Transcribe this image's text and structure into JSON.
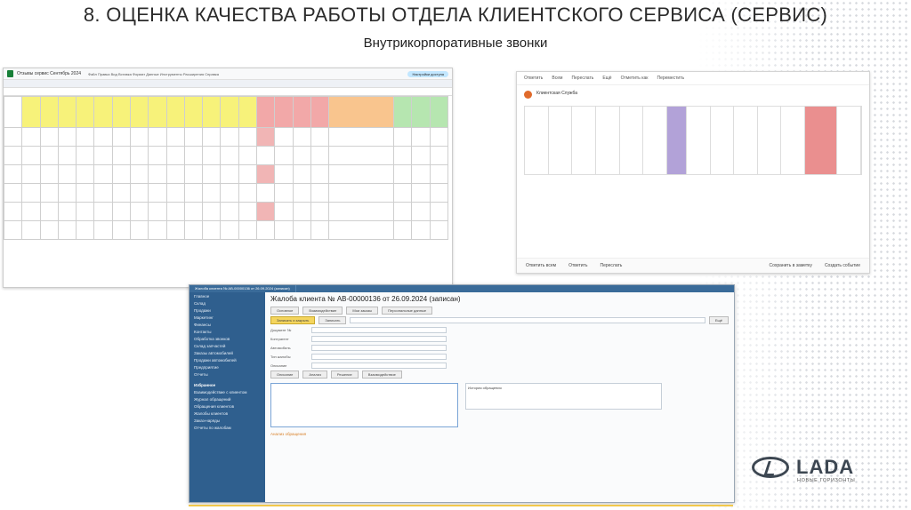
{
  "slide": {
    "title": "8. ОЦЕНКА КАЧЕСТВА РАБОТЫ ОТДЕЛА КЛИЕНТСКОГО СЕРВИСА (СЕРВИС)",
    "subtitle": "Внутрикорпоративные звонки"
  },
  "spreadsheet": {
    "doc_title": "Отзывы сервис Сентябрь 2024",
    "menu": "Файл Правка Вид Вставка Формат Данные Инструменты Расширения Справка",
    "share_label": "Настройки доступа",
    "rows": 6,
    "cols": 22
  },
  "email": {
    "toolbar": [
      "Ответить",
      "Всем",
      "Переслать",
      "Ещё",
      "Отметить как",
      "Переместить"
    ],
    "sender": "Клиентская Служба",
    "footer": [
      "Ответить всем",
      "Ответить",
      "Переслать",
      "Сохранить в заметку",
      "Создать событие"
    ]
  },
  "crm": {
    "window_title": "Жалоба клиента № АВ-00000136 от 26.09.2024 (записан)",
    "tabs": [
      "Основное",
      "Взаимодействие",
      "Мои заказы",
      "Персональные данные"
    ],
    "buttons": {
      "save_close": "Записать и закрыть",
      "write": "Записать",
      "more": "Ещё"
    },
    "sidebar": [
      "Главное",
      "Склад",
      "Продажи",
      "Маркетинг",
      "Финансы",
      "Контакты",
      "Обработка звонков",
      "Склад запчастей",
      "Заказы автомобилей",
      "Продажи автомобилей",
      "Предприятие",
      "Отчеты"
    ],
    "sidebar_section": "Избранное",
    "sidebar_fav": [
      "Взаимодействие с клиентом",
      "Журнал обращений",
      "Обращения клиентов",
      "Жалобы клиентов",
      "Заказ-наряды",
      "Отчеты по жалобам"
    ],
    "form_labels": [
      "Документ №",
      "Контрагент",
      "Автомобиль",
      "Тип жалобы",
      "Описание"
    ],
    "sub_tabs": [
      "Описание",
      "Анализ",
      "Решение",
      "Взаимодействие"
    ],
    "section_label": "Анализ обращения",
    "right_header": "История обращения"
  },
  "logo": {
    "word": "LADA",
    "tagline": "НОВЫЕ ГОРИЗОНТЫ"
  }
}
